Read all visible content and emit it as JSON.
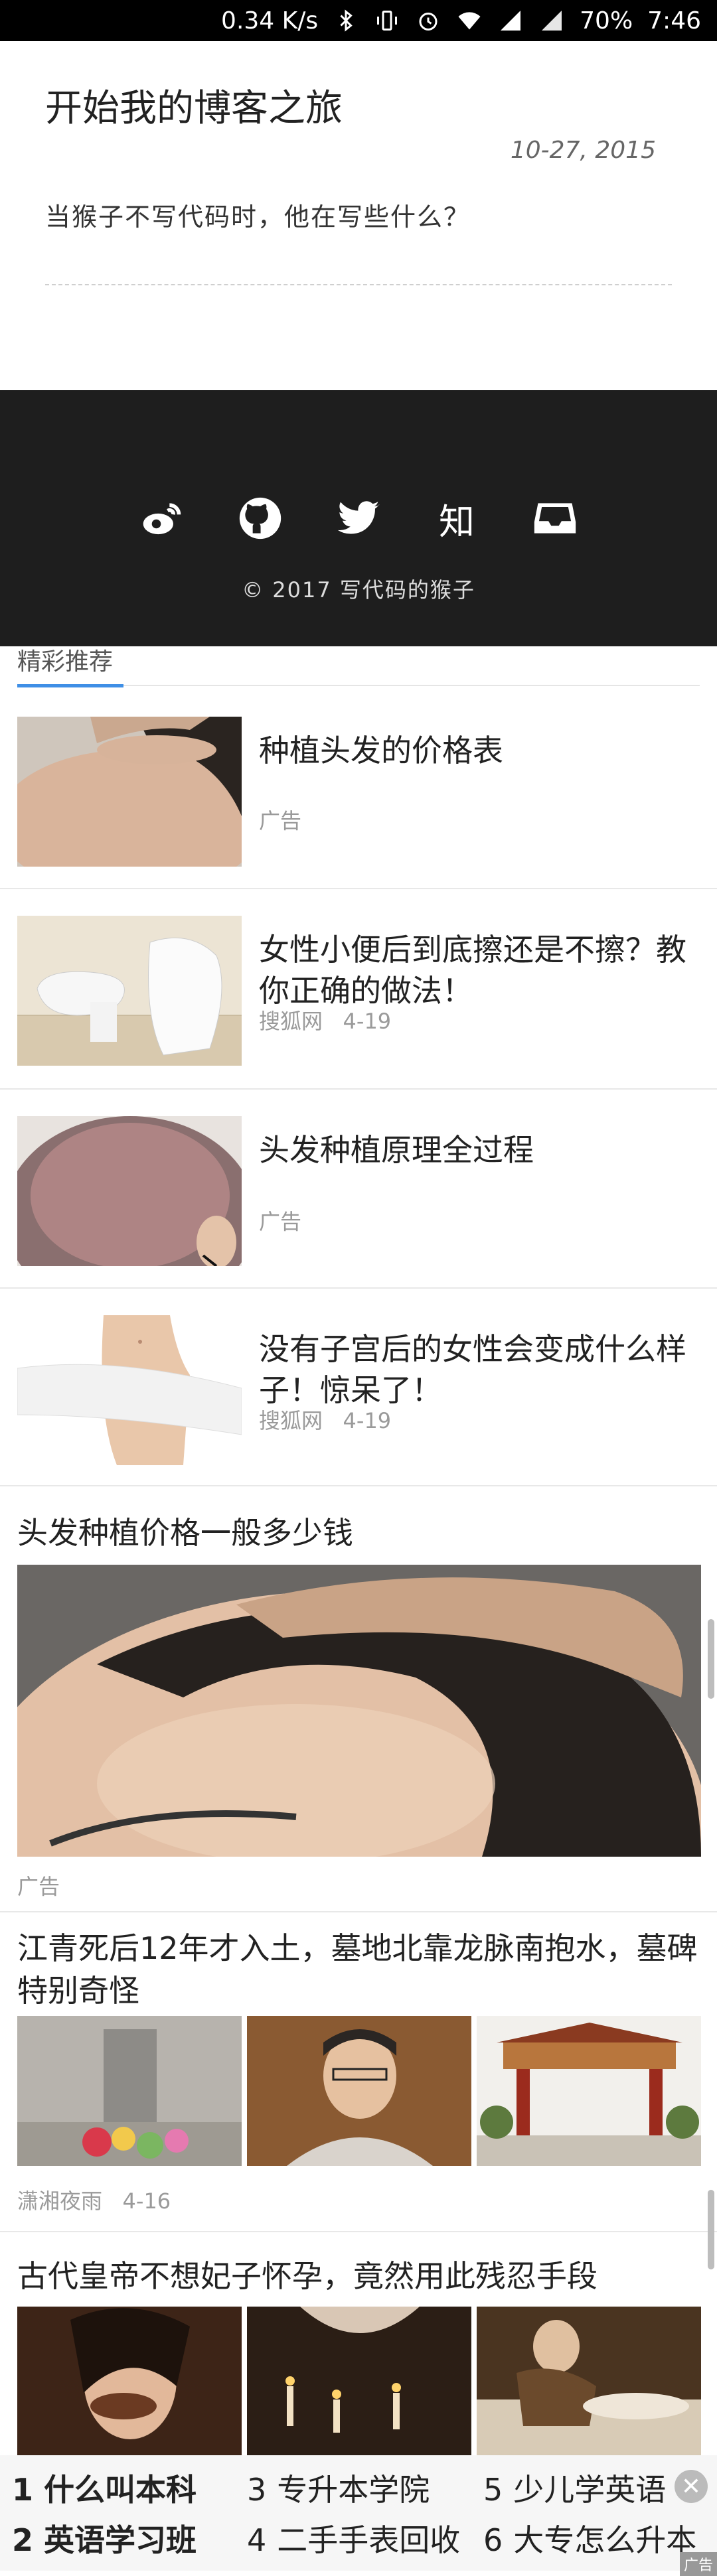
{
  "status_bar": {
    "speed": "0.34 K/s",
    "battery": "70%",
    "time": "7:46"
  },
  "post": {
    "title": "开始我的博客之旅",
    "date": "10-27, 2015",
    "excerpt": "当猴子不写代码时，他在写些什么？"
  },
  "footer": {
    "social": [
      {
        "icon": "weibo-icon"
      },
      {
        "icon": "github-icon"
      },
      {
        "icon": "twitter-icon"
      },
      {
        "icon": "zhihu-icon",
        "glyph": "知"
      },
      {
        "icon": "inbox-icon"
      }
    ],
    "copyright": "© 2017 写代码的猴子"
  },
  "recommend": {
    "tab_label": "精彩推荐",
    "items": [
      {
        "title": "种植头发的价格表",
        "meta": "广告"
      },
      {
        "title": "女性小便后到底擦还是不擦？教你正确的做法！",
        "source": "搜狐网",
        "date": "4-19"
      },
      {
        "title": "头发种植原理全过程",
        "meta": "广告"
      },
      {
        "title": "没有子宫后的女性会变成什么样子！惊呆了！",
        "source": "搜狐网",
        "date": "4-19"
      }
    ],
    "big_ad": {
      "title": "头发种植价格一般多少钱",
      "meta": "广告"
    },
    "article_1": {
      "title": "江青死后12年才入土，墓地北靠龙脉南抱水，墓碑特别奇怪",
      "source": "潇湘夜雨",
      "date": "4-16"
    },
    "article_2": {
      "title": "古代皇帝不想妃子怀孕，竟然用此残忍手段"
    }
  },
  "bottom_ad": {
    "items": [
      {
        "num": "1",
        "text": "什么叫本科"
      },
      {
        "num": "3",
        "text": "专升本学院"
      },
      {
        "num": "5",
        "text": "少儿学英语"
      },
      {
        "num": "2",
        "text": "英语学习班"
      },
      {
        "num": "4",
        "text": "二手手表回收"
      },
      {
        "num": "6",
        "text": "大专怎么升本"
      }
    ],
    "badge": "广告",
    "close": "✕"
  },
  "colors": {
    "footer_bg": "#1e1e1e",
    "tab_accent": "#3f8fe6"
  }
}
